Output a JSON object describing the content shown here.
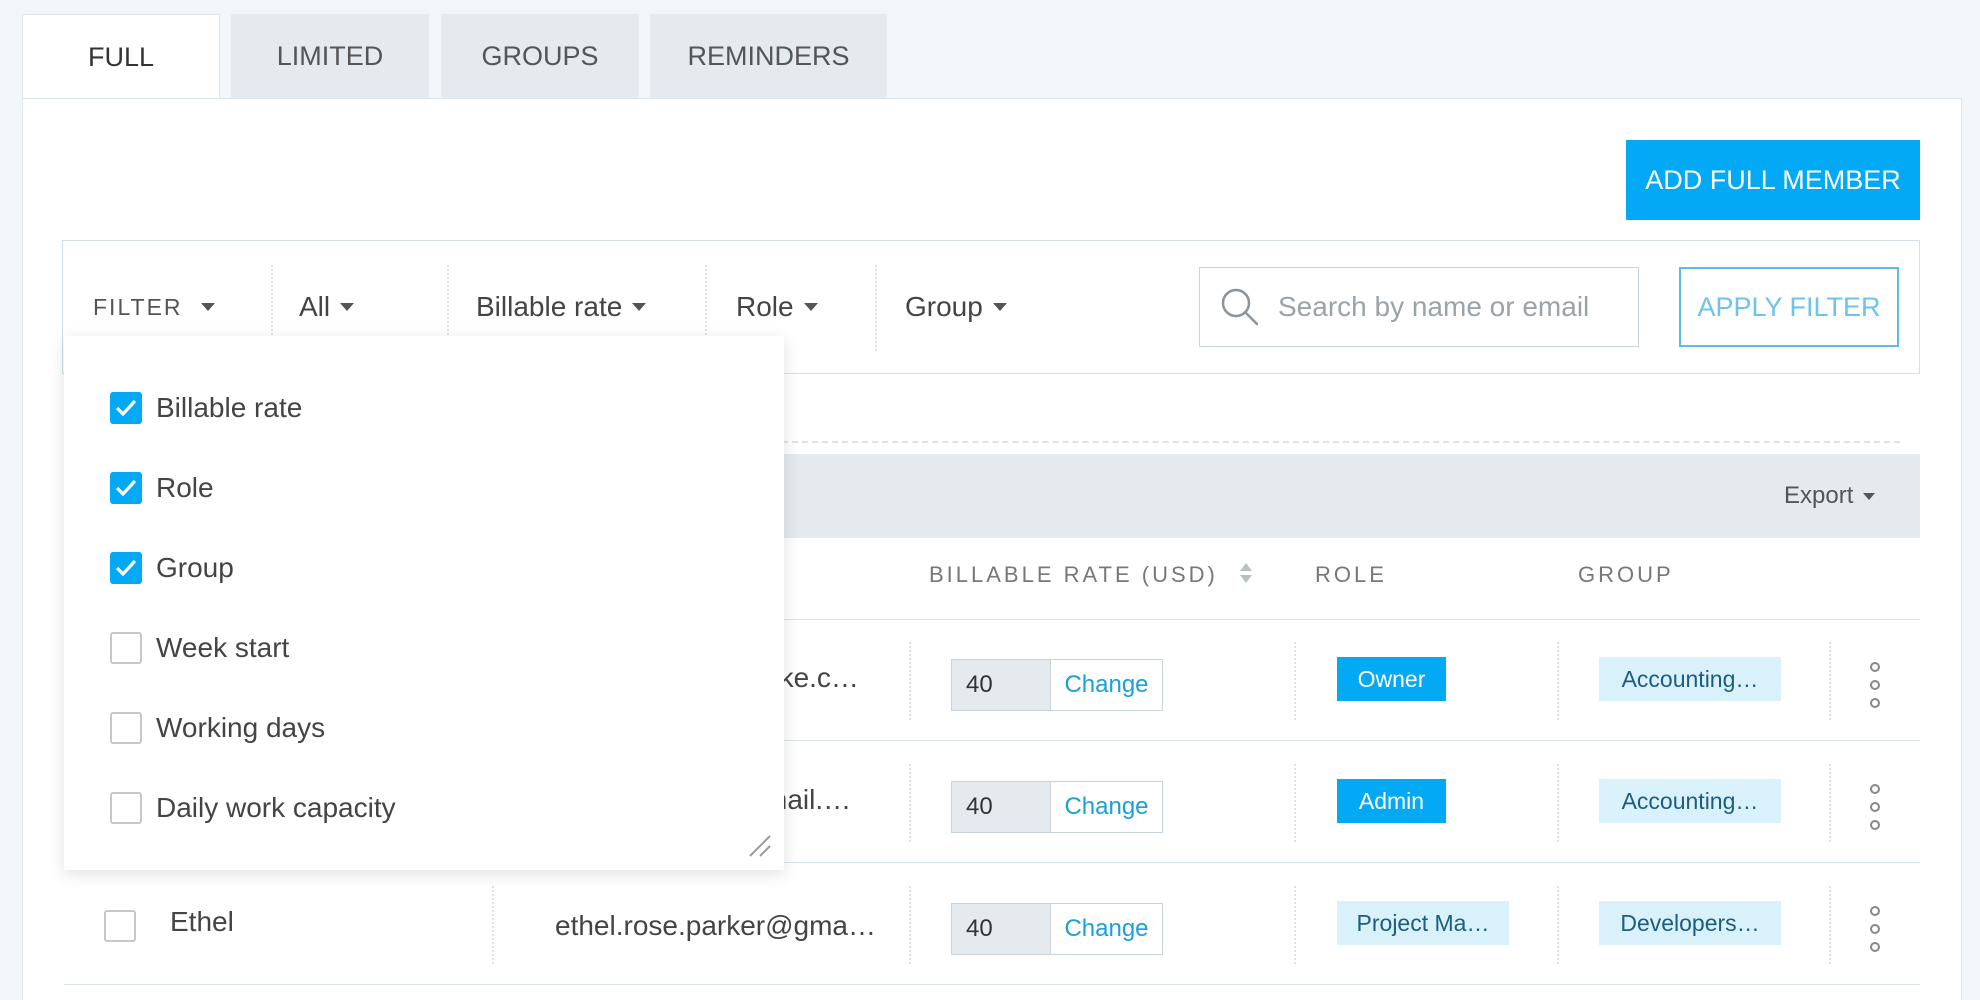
{
  "tabs": [
    {
      "label": "FULL",
      "active": true
    },
    {
      "label": "LIMITED",
      "active": false
    },
    {
      "label": "GROUPS",
      "active": false
    },
    {
      "label": "REMINDERS",
      "active": false
    }
  ],
  "actions": {
    "add_member": "ADD FULL MEMBER"
  },
  "filter_bar": {
    "filter_label": "FILTER",
    "dropdowns": [
      "All",
      "Billable rate",
      "Role",
      "Group"
    ],
    "search_placeholder": "Search by name or email",
    "apply": "APPLY FILTER"
  },
  "filter_menu": {
    "options": [
      {
        "label": "Billable rate",
        "checked": true
      },
      {
        "label": "Role",
        "checked": true
      },
      {
        "label": "Group",
        "checked": true
      },
      {
        "label": "Week start",
        "checked": false
      },
      {
        "label": "Working days",
        "checked": false
      },
      {
        "label": "Daily work capacity",
        "checked": false
      }
    ]
  },
  "table": {
    "export": "Export",
    "columns": [
      "BILLABLE RATE (USD)",
      "ROLE",
      "GROUP"
    ],
    "rows": [
      {
        "name": "",
        "email": "ake.c…",
        "rate": "40",
        "change": "Change",
        "role": "Owner",
        "role_style": "solid",
        "group": "Accounting…"
      },
      {
        "name": "",
        "email": "mail.…",
        "rate": "40",
        "change": "Change",
        "role": "Admin",
        "role_style": "solid",
        "group": "Accounting…"
      },
      {
        "name": "Ethel",
        "email": "ethel.rose.parker@gma…",
        "rate": "40",
        "change": "Change",
        "role": "Project Ma…",
        "role_style": "soft",
        "group": "Developers…"
      }
    ]
  },
  "colors": {
    "accent": "#03a9f4",
    "badge_soft": "#d9f1fb",
    "header_bg": "#e4eaee"
  }
}
